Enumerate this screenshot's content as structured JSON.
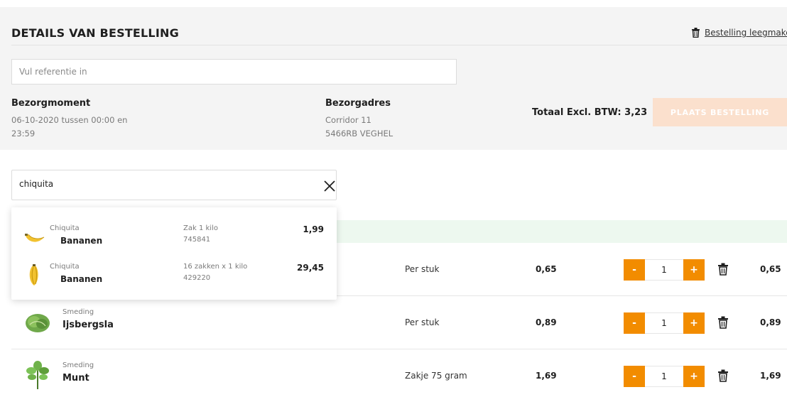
{
  "order": {
    "title": "DETAILS VAN BESTELLING",
    "clear_label": "Bestelling leegmake",
    "reference_placeholder": "Vul referentie in",
    "delivery_moment_label": "Bezorgmoment",
    "delivery_moment_line1": "06-10-2020 tussen 00:00 en",
    "delivery_moment_line2": "23:59",
    "address_label": "Bezorgadres",
    "address_line1": "Corridor 11",
    "address_line2": "5466RB VEGHEL",
    "total_label": "Totaal Excl. BTW: 3,23",
    "place_order_label": "PLAATS BESTELLING",
    "place_order_color": "#fbe0cd"
  },
  "search": {
    "value": "chiquita",
    "clear_icon": "close-icon",
    "suggestions": [
      {
        "brand": "Chiquita",
        "name": "Bananen",
        "pack": "Zak 1 kilo",
        "code": "745841",
        "price": "1,99",
        "icon": "banana-icon"
      },
      {
        "brand": "Chiquita",
        "name": "Bananen",
        "pack": "16 zakken x 1 kilo",
        "code": "429220",
        "price": "29,45",
        "icon": "banana-box-icon"
      }
    ]
  },
  "rows": [
    {
      "brand": "",
      "name": "",
      "unit": "Per stuk",
      "unit_price": "0,65",
      "qty": "1",
      "total": "0,65"
    },
    {
      "brand": "Smeding",
      "name": "Ijsbergsla",
      "unit": "Per stuk",
      "unit_price": "0,89",
      "qty": "1",
      "total": "0,89",
      "icon": "lettuce-icon"
    },
    {
      "brand": "Smeding",
      "name": "Munt",
      "unit": "Zakje 75 gram",
      "unit_price": "1,69",
      "qty": "1",
      "total": "1,69",
      "icon": "mint-icon"
    }
  ],
  "stepper": {
    "minus": "-",
    "plus": "+"
  },
  "colors": {
    "accent": "#f28c00",
    "highlight": "#edf8ef"
  }
}
